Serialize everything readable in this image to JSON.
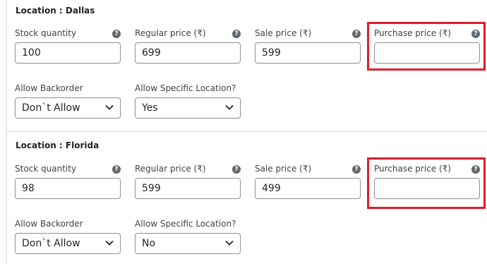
{
  "locations": [
    {
      "title": "Location : Dallas",
      "stock_label": "Stock quantity",
      "stock_value": "100",
      "regular_label": "Regular price (₹)",
      "regular_value": "699",
      "sale_label": "Sale price (₹)",
      "sale_value": "599",
      "purchase_label": "Purchase price (₹)",
      "purchase_value": "",
      "backorder_label": "Allow Backorder",
      "backorder_value": "Don`t Allow",
      "specific_label": "Allow Specific Location?",
      "specific_value": "Yes"
    },
    {
      "title": "Location : Florida",
      "stock_label": "Stock quantity",
      "stock_value": "98",
      "regular_label": "Regular price (₹)",
      "regular_value": "599",
      "sale_label": "Sale price (₹)",
      "sale_value": "499",
      "purchase_label": "Purchase price (₹)",
      "purchase_value": "",
      "backorder_label": "Allow Backorder",
      "backorder_value": "Don`t Allow",
      "specific_label": "Allow Specific Location?",
      "specific_value": "No"
    }
  ],
  "icons": {
    "help": "help-circle-icon",
    "select_arrow": "chevron-down-icon"
  },
  "colors": {
    "highlight": "#e11d2c",
    "help_icon": "#646970",
    "border": "#8c8f94"
  }
}
